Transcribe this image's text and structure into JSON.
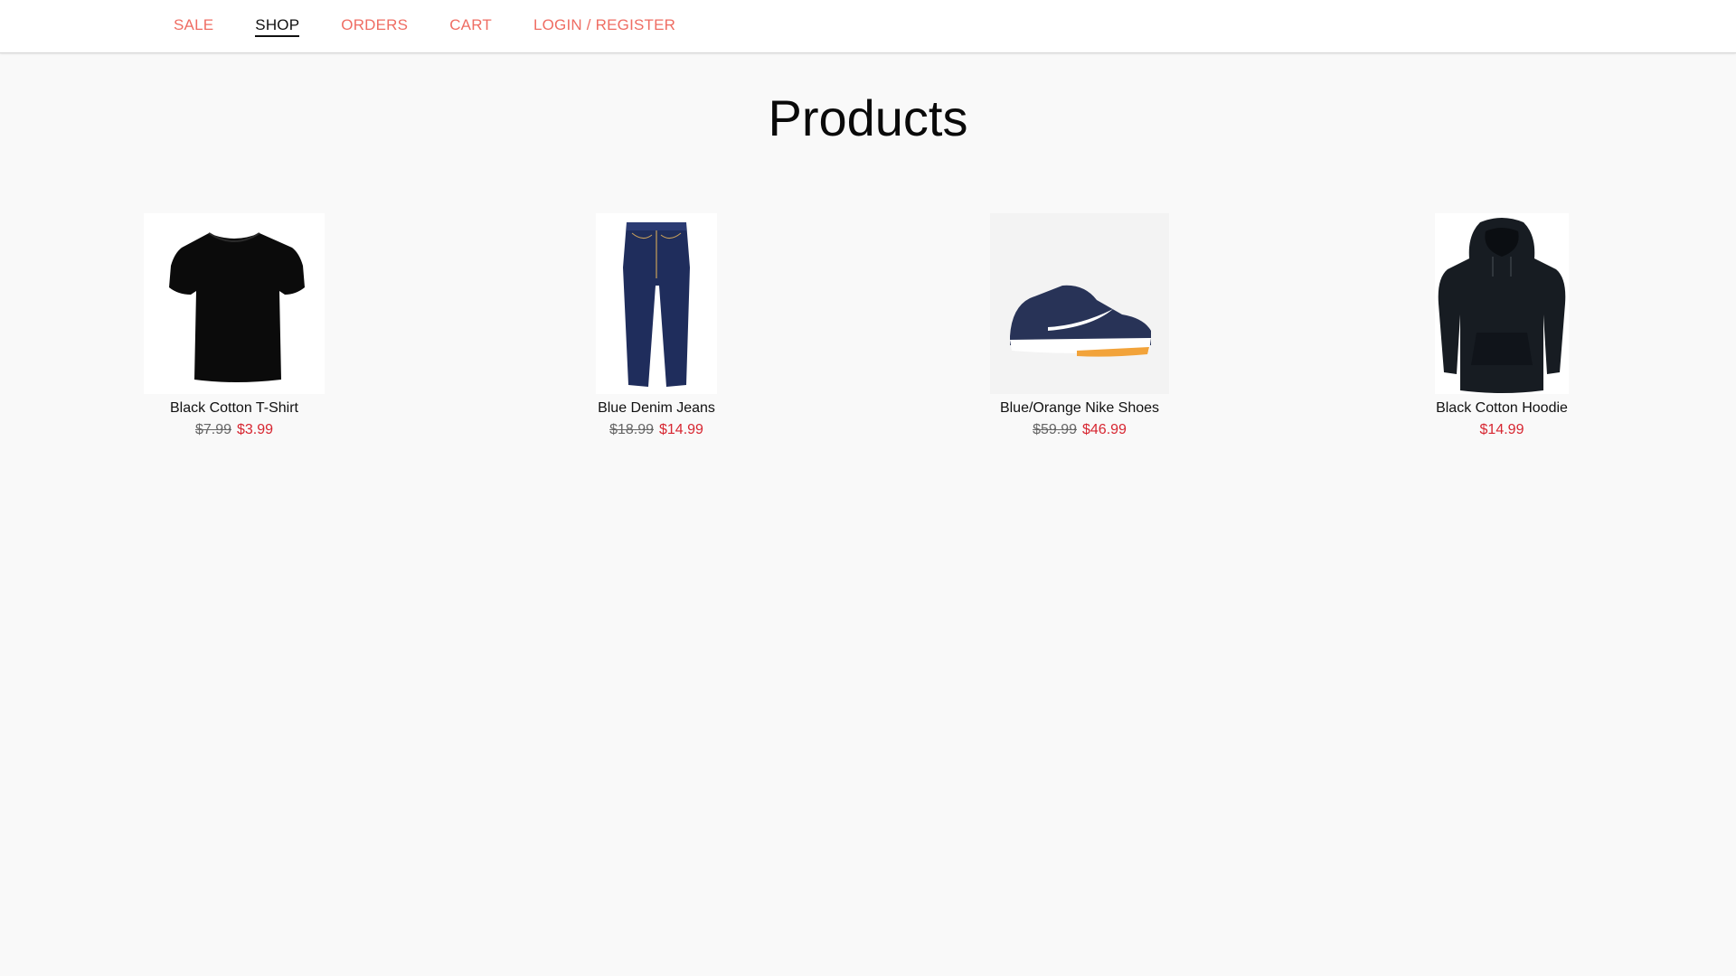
{
  "nav": {
    "items": [
      {
        "label": "SALE",
        "active": false
      },
      {
        "label": "SHOP",
        "active": true
      },
      {
        "label": "ORDERS",
        "active": false
      },
      {
        "label": "CART",
        "active": false
      },
      {
        "label": "LOGIN / REGISTER",
        "active": false
      }
    ]
  },
  "page": {
    "title": "Products"
  },
  "products": [
    {
      "name": "Black Cotton T-Shirt",
      "old_price": "$7.99",
      "price": "$3.99",
      "image": "black-tshirt"
    },
    {
      "name": "Blue Denim Jeans",
      "old_price": "$18.99",
      "price": "$14.99",
      "image": "blue-jeans"
    },
    {
      "name": "Blue/Orange Nike Shoes",
      "old_price": "$59.99",
      "price": "$46.99",
      "image": "nike-shoes"
    },
    {
      "name": "Black Cotton Hoodie",
      "old_price": "",
      "price": "$14.99",
      "image": "black-hoodie"
    }
  ],
  "colors": {
    "accent": "#ef6d63",
    "sale_price": "#d72631",
    "active_nav": "#111111",
    "background": "#f9f9f9"
  }
}
